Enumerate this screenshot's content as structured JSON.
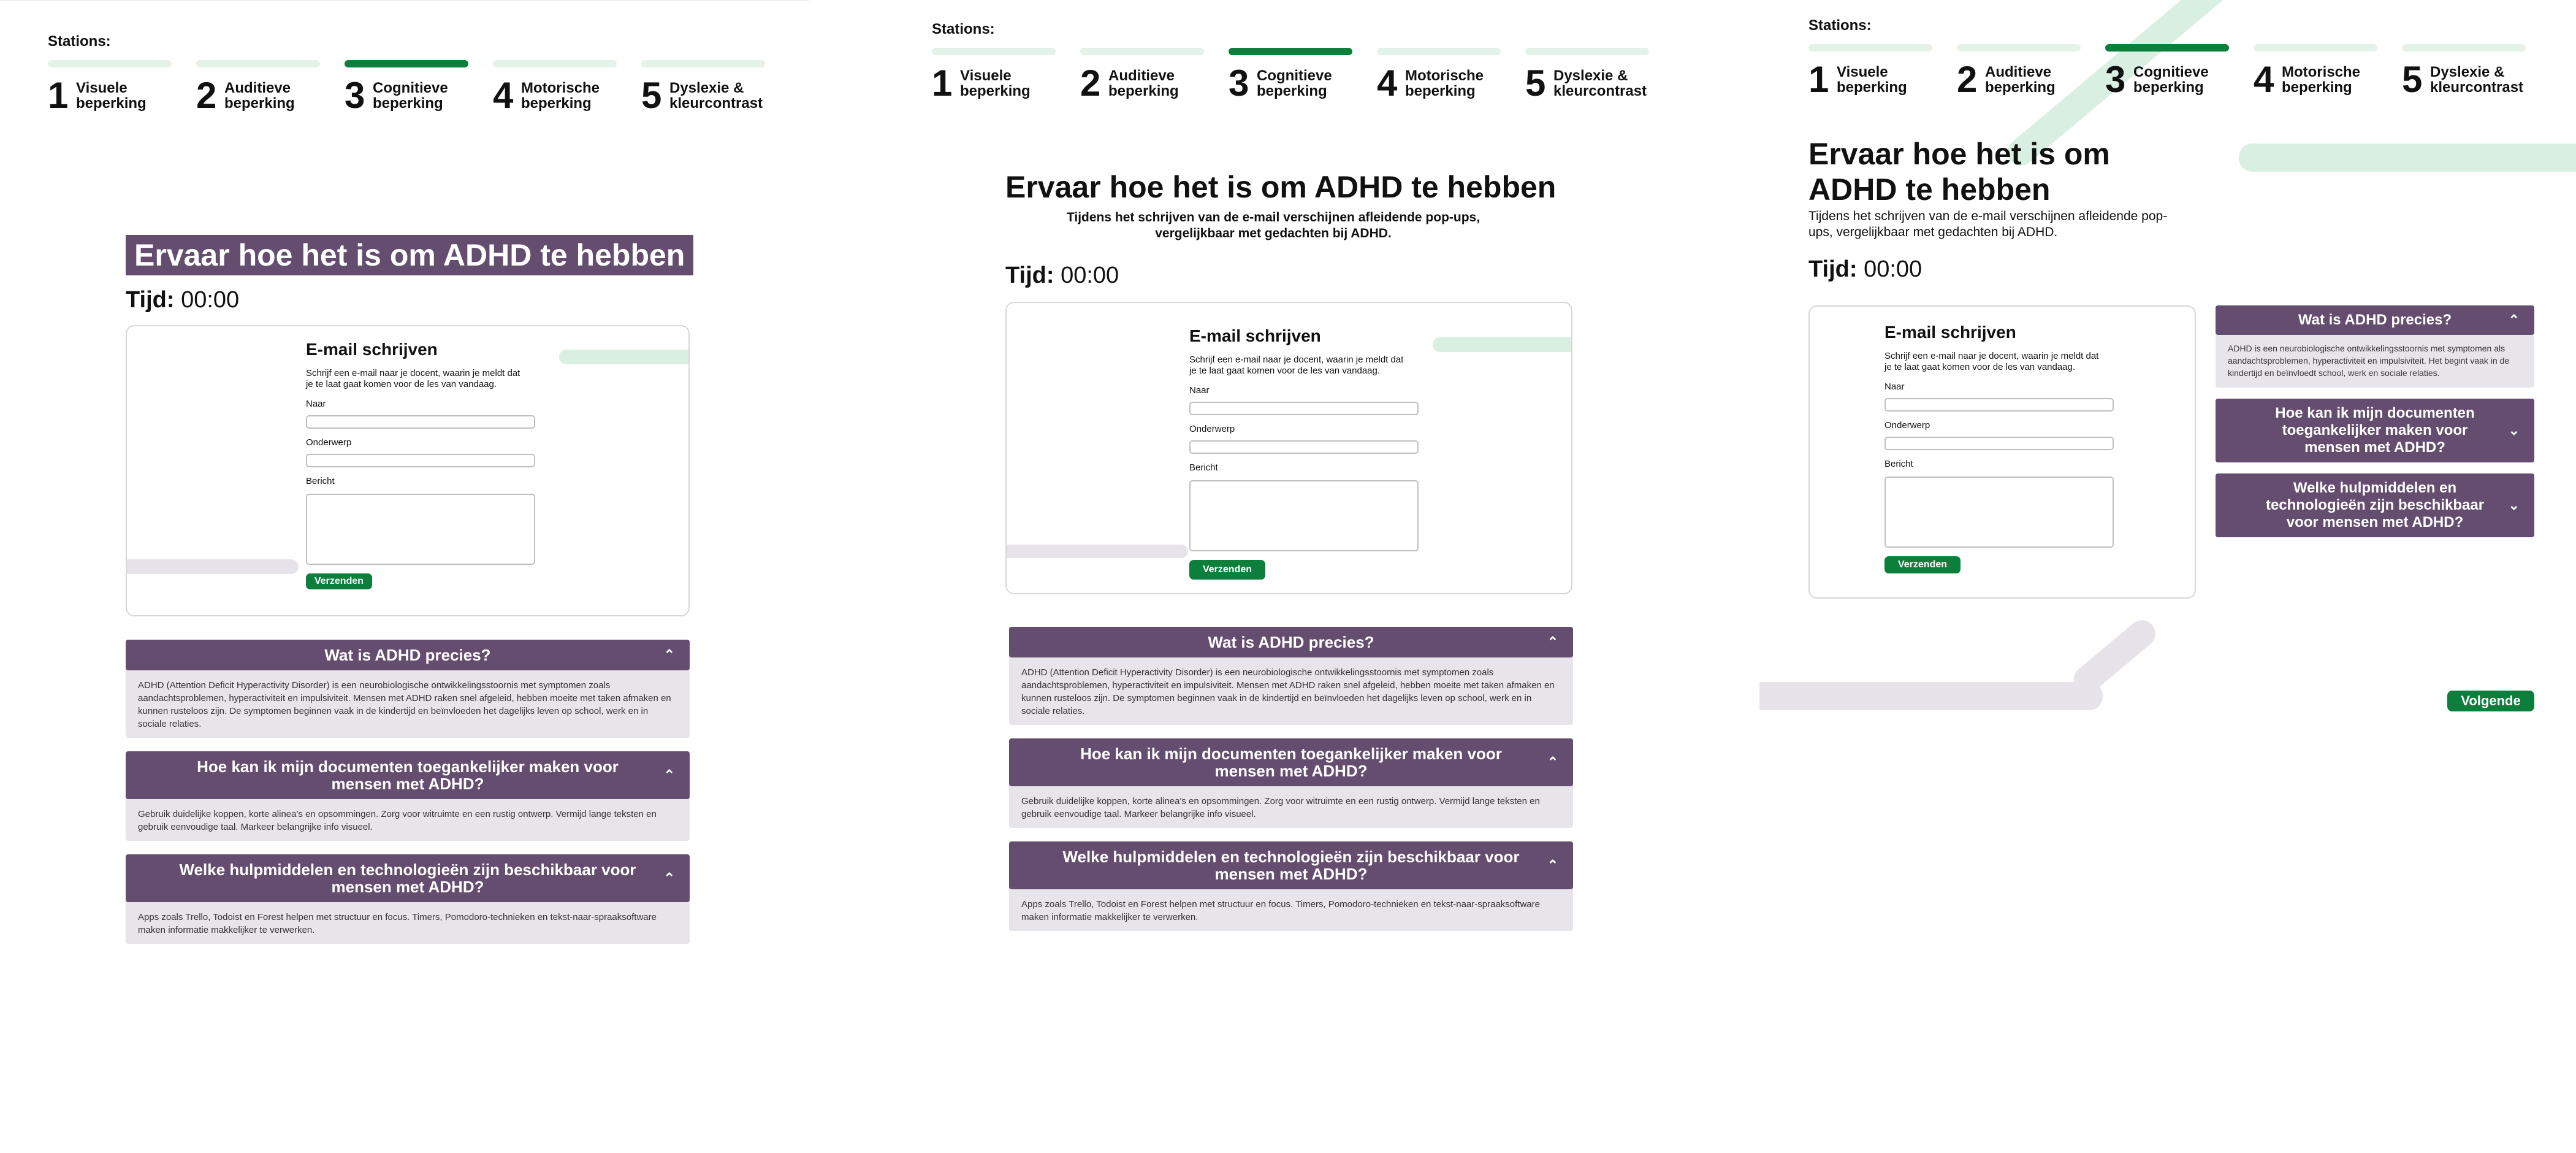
{
  "stations": {
    "title": "Stations:",
    "items": [
      {
        "num": "1",
        "line1": "Visuele",
        "line2": "beperking"
      },
      {
        "num": "2",
        "line1": "Auditieve",
        "line2": "beperking"
      },
      {
        "num": "3",
        "line1": "Cognitieve",
        "line2": "beperking"
      },
      {
        "num": "4",
        "line1": "Motorische",
        "line2": "beperking"
      },
      {
        "num": "5",
        "line1": "Dyslexie &",
        "line2": "kleurcontrast"
      }
    ],
    "active_index": 2
  },
  "page": {
    "heading": "Ervaar hoe het is om ADHD te hebben",
    "subtitle_line1": "Tijdens het schrijven van de e-mail verschijnen afleidende pop-ups,",
    "subtitle_line2": "vergelijkbaar met gedachten bij ADHD.",
    "timer_label": "Tijd:",
    "timer_value": "00:00"
  },
  "form": {
    "title": "E-mail schrijven",
    "desc_line1": "Schrijf een e-mail naar je docent, waarin je meldt dat",
    "desc_line2": "je te laat gaat komen voor de les van vandaag.",
    "to_label": "Naar",
    "subject_label": "Onderwerp",
    "message_label": "Bericht",
    "send_label": "Verzenden"
  },
  "accordion": [
    {
      "question": "Wat is ADHD precies?",
      "answer": "ADHD (Attention Deficit Hyperactivity Disorder) is een neurobiologische ontwikkelingsstoornis met symptomen zoals aandachtsproblemen, hyperactiviteit en impulsiviteit. Mensen met ADHD raken snel afgeleid, hebben moeite met taken afmaken en kunnen rusteloos zijn. De symptomen beginnen vaak in de kindertijd en beïnvloeden het dagelijks leven op school, werk en in sociale relaties.",
      "answer_short": "ADHD is een neurobiologische ontwikkelingsstoornis met symptomen als aandachtsproblemen, hyperactiviteit en impulsiviteit. Het begint vaak in de kindertijd en beïnvloedt school, werk en sociale relaties."
    },
    {
      "question": "Hoe kan ik mijn documenten toegankelijker maken voor mensen met ADHD?",
      "answer": "Gebruik duidelijke koppen, korte alinea's en opsommingen. Zorg voor witruimte en een rustig ontwerp. Vermijd lange teksten en gebruik eenvoudige taal. Markeer belangrijke info visueel."
    },
    {
      "question": "Welke hulpmiddelen en technologieën zijn beschikbaar voor mensen met ADHD?",
      "answer": "Apps zoals Trello, Todoist en Forest helpen met structuur en focus. Timers, Pomodoro-technieken en tekst-naar-spraaksoftware maken informatie makkelijker te verwerken."
    }
  ],
  "next_label": "Volgende",
  "icons": {
    "chevron_up": "chevron-up-icon",
    "chevron_down": "chevron-down-icon"
  },
  "colors": {
    "accent_green": "#0b7f3b",
    "light_green": "#e4f3ea",
    "purple": "#654d70",
    "panel_grey": "#e8e5ea"
  }
}
